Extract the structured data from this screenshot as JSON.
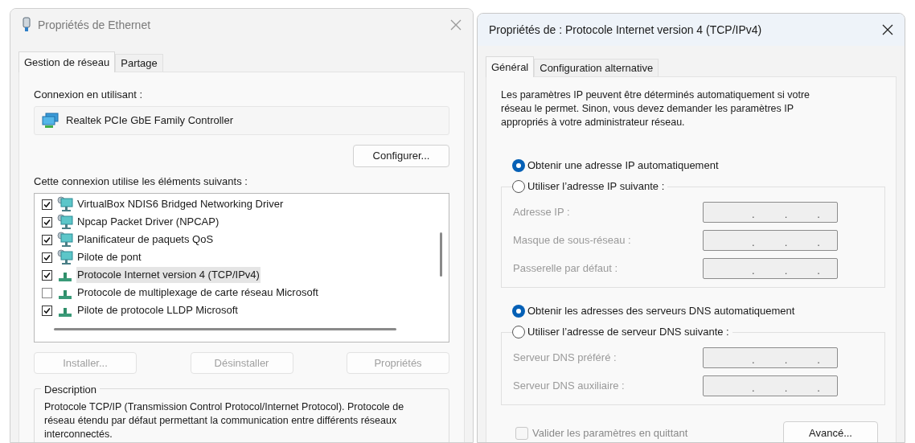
{
  "ethernet_window": {
    "title": "Propriétés de Ethernet",
    "active": false,
    "tabs": [
      {
        "label": "Gestion de réseau",
        "selected": true
      },
      {
        "label": "Partage",
        "selected": false
      }
    ],
    "connect_using_label": "Connexion en utilisant :",
    "adapter": "Realtek PCIe GbE Family Controller",
    "configure_button": "Configurer...",
    "items_label": "Cette connexion utilise les éléments suivants :",
    "items": [
      {
        "kind": "service",
        "label": "VirtualBox NDIS6 Bridged Networking Driver",
        "checked": true,
        "selected": false
      },
      {
        "kind": "service",
        "label": "Npcap Packet Driver (NPCAP)",
        "checked": true,
        "selected": false
      },
      {
        "kind": "service",
        "label": "Planificateur de paquets QoS",
        "checked": true,
        "selected": false
      },
      {
        "kind": "service",
        "label": "Pilote de pont",
        "checked": true,
        "selected": false
      },
      {
        "kind": "protocol",
        "label": "Protocole Internet version 4 (TCP/IPv4)",
        "checked": true,
        "selected": true
      },
      {
        "kind": "protocol",
        "label": "Protocole de multiplexage de carte réseau Microsoft",
        "checked": false,
        "selected": false
      },
      {
        "kind": "protocol",
        "label": "Pilote de protocole LLDP Microsoft",
        "checked": true,
        "selected": false
      }
    ],
    "buttons": [
      {
        "label": "Installer...",
        "disabled": true
      },
      {
        "label": "Désinstaller",
        "disabled": true
      },
      {
        "label": "Propriétés",
        "disabled": true
      }
    ],
    "description": {
      "legend": "Description",
      "text": "Protocole TCP/IP (Transmission Control Protocol/Internet Protocol). Protocole de réseau étendu par défaut permettant la communication entre différents réseaux interconnectés."
    }
  },
  "ipv4_window": {
    "title": "Propriétés de : Protocole Internet version 4 (TCP/IPv4)",
    "active": true,
    "tabs": [
      {
        "label": "Général",
        "selected": true
      },
      {
        "label": "Configuration alternative",
        "selected": false
      }
    ],
    "intro": "Les paramètres IP peuvent être déterminés automatiquement si votre réseau le permet. Sinon, vous devez demander les paramètres IP appropriés à votre administrateur réseau.",
    "ip_section": {
      "radios": [
        {
          "label": "Obtenir une adresse IP automatiquement",
          "selected": true
        },
        {
          "label": "Utiliser l’adresse IP suivante :",
          "selected": false
        }
      ],
      "fields": [
        {
          "label": "Adresse IP :",
          "separators": [
            ".",
            ".",
            "."
          ],
          "disabled": true
        },
        {
          "label": "Masque de sous-réseau :",
          "separators": [
            ".",
            ".",
            "."
          ],
          "disabled": true
        },
        {
          "label": "Passerelle par défaut :",
          "separators": [
            ".",
            ".",
            "."
          ],
          "disabled": true
        }
      ]
    },
    "dns_section": {
      "radios": [
        {
          "label": "Obtenir les adresses des serveurs DNS automatiquement",
          "selected": true
        },
        {
          "label": "Utiliser l’adresse de serveur DNS suivante :",
          "selected": false
        }
      ],
      "fields": [
        {
          "label": "Serveur DNS préféré :",
          "separators": [
            ".",
            ".",
            "."
          ],
          "disabled": true
        },
        {
          "label": "Serveur DNS auxiliaire :",
          "separators": [
            ".",
            ".",
            "."
          ],
          "disabled": true
        }
      ]
    },
    "validate": {
      "label": "Valider les paramètres en quittant",
      "checked": false,
      "disabled": true
    },
    "advanced_button": "Avancé..."
  }
}
